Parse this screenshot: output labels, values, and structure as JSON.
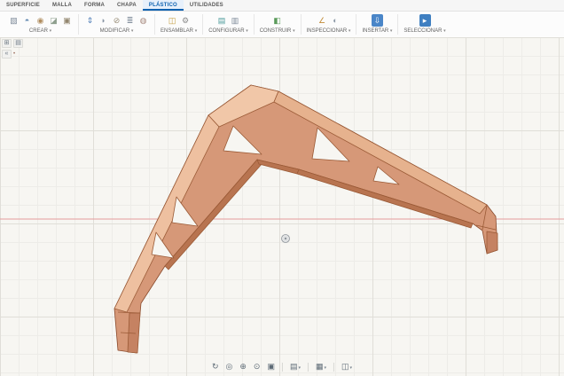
{
  "tabs": [
    {
      "label": "SUPERFICIE",
      "active": false
    },
    {
      "label": "MALLA",
      "active": false
    },
    {
      "label": "FORMA",
      "active": false
    },
    {
      "label": "CHAPA",
      "active": false
    },
    {
      "label": "PLÁSTICO",
      "active": true
    },
    {
      "label": "UTILIDADES",
      "active": false
    }
  ],
  "toolbar": {
    "groups": [
      {
        "label": "CREAR",
        "icons": [
          {
            "name": "new-component-icon",
            "glyph": "▧",
            "color": "#7d8a99"
          },
          {
            "name": "extrude-icon",
            "glyph": "◓",
            "color": "#5f87b0"
          },
          {
            "name": "revolve-icon",
            "glyph": "◉",
            "color": "#b08d5f"
          },
          {
            "name": "sweep-icon",
            "glyph": "◪",
            "color": "#8fa08f"
          },
          {
            "name": "primitive-box-icon",
            "glyph": "▣",
            "color": "#93876f"
          }
        ]
      },
      {
        "label": "MODIFICAR",
        "icons": [
          {
            "name": "press-pull-icon",
            "glyph": "⇕",
            "color": "#4a7ab5"
          },
          {
            "name": "fillet-icon",
            "glyph": "◗",
            "color": "#8a97a6"
          },
          {
            "name": "shell-icon",
            "glyph": "⊘",
            "color": "#9a8f7a"
          },
          {
            "name": "combine-icon",
            "glyph": "≣",
            "color": "#7d8a99"
          },
          {
            "name": "physical-material-icon",
            "glyph": "◍",
            "color": "#a6887d"
          }
        ]
      },
      {
        "label": "ENSAMBLAR",
        "icons": [
          {
            "name": "new-component-assembly-icon",
            "glyph": "◫",
            "color": "#c29a3a"
          },
          {
            "name": "joint-icon",
            "glyph": "⚙",
            "color": "#8c8c8c"
          }
        ]
      },
      {
        "label": "CONFIGURAR",
        "icons": [
          {
            "name": "configuration-table-icon",
            "glyph": "▤",
            "color": "#4a9a9a"
          },
          {
            "name": "configuration-theme-icon",
            "glyph": "▥",
            "color": "#7d8a99"
          }
        ]
      },
      {
        "label": "CONSTRUIR",
        "icons": [
          {
            "name": "construction-plane-icon",
            "glyph": "◧",
            "color": "#5a9a5a"
          }
        ]
      },
      {
        "label": "INSPECCIONAR",
        "icons": [
          {
            "name": "measure-icon",
            "glyph": "∠",
            "color": "#c28c3a"
          },
          {
            "name": "section-analysis-icon",
            "glyph": "◐",
            "color": "#8c99a6"
          }
        ]
      },
      {
        "label": "INSERTAR",
        "icons": [
          {
            "name": "insert-icon",
            "glyph": "⇩",
            "color": "#ffffff",
            "bg": "#4a86c8"
          }
        ]
      },
      {
        "label": "SELECCIONAR",
        "icons": [
          {
            "name": "select-cursor-icon",
            "glyph": "▸",
            "color": "#ffffff",
            "bg": "#3f7fc1"
          }
        ]
      }
    ]
  },
  "browser": {
    "toggles": [
      {
        "name": "data-panel-toggle-icon",
        "glyph": "⊞"
      },
      {
        "name": "browser-panel-toggle-icon",
        "glyph": "▤"
      }
    ],
    "collapse_glyph": "«",
    "bullet_glyph": "•"
  },
  "viewport": {
    "background": "#f7f6f2",
    "grid_minor_color": "#edece8",
    "grid_major_color": "#e0ded8",
    "axis_line_color": "#e59c9c"
  },
  "model": {
    "description": "V-shaped plastic bracket with triangular cutouts",
    "face_color": "#d69878",
    "top_face_color": "#f1c7a8",
    "top_strip_left_color": "#eec0a0",
    "top_strip_right_color": "#e6b28e",
    "inner_face_color": "#b87450",
    "foot_shade_color": "#c58262",
    "edge_color": "#9a5a36"
  },
  "navbar": {
    "buttons": [
      {
        "name": "orbit-button",
        "glyph": "↻"
      },
      {
        "name": "look-at-button",
        "glyph": "◎"
      },
      {
        "name": "pan-button",
        "glyph": "⊕"
      },
      {
        "name": "zoom-button",
        "glyph": "⊙"
      },
      {
        "name": "fit-button",
        "glyph": "▣"
      },
      {
        "separator": true
      },
      {
        "name": "display-settings-button",
        "glyph": "▤",
        "dropdown": true
      },
      {
        "separator": true
      },
      {
        "name": "grid-snaps-button",
        "glyph": "▦",
        "dropdown": true
      },
      {
        "separator": true
      },
      {
        "name": "viewports-button",
        "glyph": "◫",
        "dropdown": true
      }
    ]
  }
}
